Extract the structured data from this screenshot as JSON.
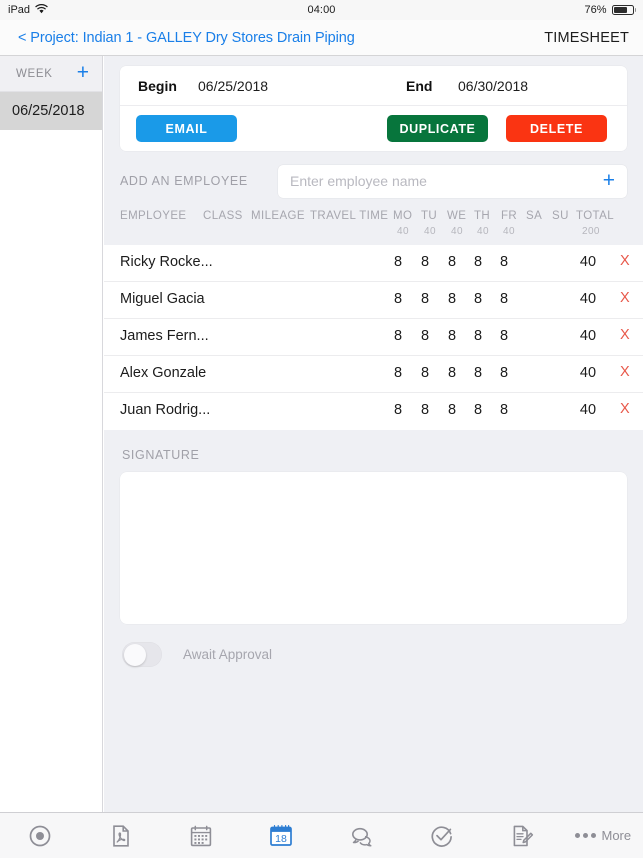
{
  "status_bar": {
    "device": "iPad",
    "wifi_icon": "wifi-icon",
    "time": "04:00",
    "battery_percent": "76%",
    "battery_level": 76
  },
  "nav": {
    "back_label": "< Project: Indian 1 - GALLEY Dry Stores Drain Piping",
    "title": "TIMESHEET"
  },
  "sidebar": {
    "header_label": "WEEK",
    "add_icon": "+",
    "weeks": [
      {
        "label": "06/25/2018",
        "selected": true
      }
    ]
  },
  "date_card": {
    "begin_label": "Begin",
    "begin_value": "06/25/2018",
    "end_label": "End",
    "end_value": "06/30/2018",
    "email_label": "EMAIL",
    "duplicate_label": "DUPLICATE",
    "delete_label": "DELETE",
    "email_color": "#1a9ae8",
    "duplicate_color": "#07753c",
    "delete_color": "#fa3412"
  },
  "add_employee": {
    "label": "ADD AN EMPLOYEE",
    "placeholder": "Enter employee name",
    "value": "",
    "add_icon": "+"
  },
  "table": {
    "headers": {
      "employee": "EMPLOYEE",
      "class": "CLASS",
      "mileage": "MILEAGE",
      "travel_time": "TRAVEL TIME",
      "mo": "MO",
      "tu": "TU",
      "we": "WE",
      "th": "TH",
      "fr": "FR",
      "sa": "SA",
      "su": "SU",
      "total": "TOTAL"
    },
    "header_totals": {
      "mo": "40",
      "tu": "40",
      "we": "40",
      "th": "40",
      "fr": "40",
      "sa": "",
      "su": "",
      "total": "200"
    },
    "rows": [
      {
        "name": "Ricky Rocke...",
        "class": "",
        "mileage": "",
        "travel_time": "",
        "mo": "8",
        "tu": "8",
        "we": "8",
        "th": "8",
        "fr": "8",
        "sa": "",
        "su": "",
        "total": "40",
        "delete_icon": "X"
      },
      {
        "name": "Miguel Gacia",
        "class": "",
        "mileage": "",
        "travel_time": "",
        "mo": "8",
        "tu": "8",
        "we": "8",
        "th": "8",
        "fr": "8",
        "sa": "",
        "su": "",
        "total": "40",
        "delete_icon": "X"
      },
      {
        "name": "James Fern...",
        "class": "",
        "mileage": "",
        "travel_time": "",
        "mo": "8",
        "tu": "8",
        "we": "8",
        "th": "8",
        "fr": "8",
        "sa": "",
        "su": "",
        "total": "40",
        "delete_icon": "X"
      },
      {
        "name": "Alex Gonzale",
        "class": "",
        "mileage": "",
        "travel_time": "",
        "mo": "8",
        "tu": "8",
        "we": "8",
        "th": "8",
        "fr": "8",
        "sa": "",
        "su": "",
        "total": "40",
        "delete_icon": "X"
      },
      {
        "name": "Juan Rodrig...",
        "class": "",
        "mileage": "",
        "travel_time": "",
        "mo": "8",
        "tu": "8",
        "we": "8",
        "th": "8",
        "fr": "8",
        "sa": "",
        "su": "",
        "total": "40",
        "delete_icon": "X"
      }
    ]
  },
  "signature": {
    "label": "SIGNATURE",
    "content": ""
  },
  "approval": {
    "label": "Await Approval",
    "enabled": false
  },
  "tabbar": {
    "items": [
      {
        "icon": "target-icon",
        "label": "",
        "active": false
      },
      {
        "icon": "pdf-document-icon",
        "label": "",
        "active": false
      },
      {
        "icon": "calendar-icon",
        "label": "",
        "active": false
      },
      {
        "icon": "calendar-day-18-icon",
        "label": "18",
        "active": true
      },
      {
        "icon": "chat-bubbles-icon",
        "label": "",
        "active": false
      },
      {
        "icon": "check-circle-icon",
        "label": "",
        "active": false
      },
      {
        "icon": "document-edit-icon",
        "label": "",
        "active": false
      },
      {
        "icon": "more-icon",
        "label": "More",
        "active": false
      }
    ]
  },
  "colors": {
    "accent_blue": "#1a7fe8",
    "main_bg": "#eff0f4",
    "selected_row": "#d6d6d6"
  }
}
